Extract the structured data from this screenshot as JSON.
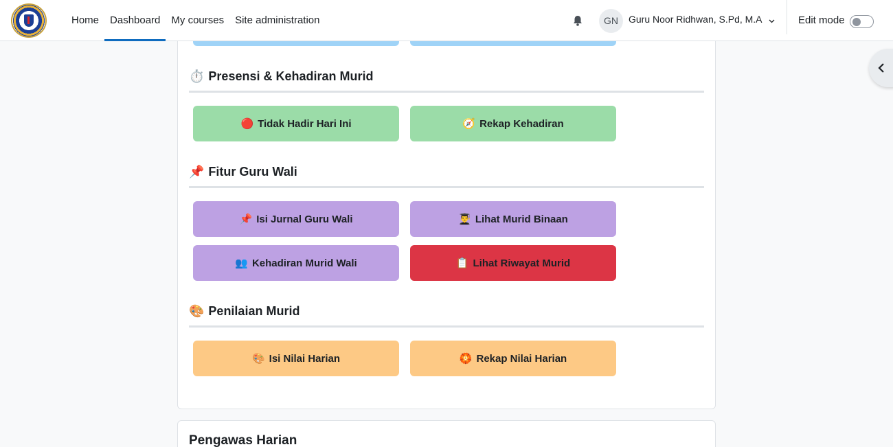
{
  "nav": {
    "links": [
      "Home",
      "Dashboard",
      "My courses",
      "Site administration"
    ],
    "active": "Dashboard",
    "avatar_initials": "GN",
    "user_name": "Guru Noor Ridhwan, S.Pd, M.A",
    "edit_mode_label": "Edit mode",
    "edit_mode_on": false
  },
  "colors": {
    "accent": "#0f6cbf",
    "blue_btn": "#9fd3f7",
    "green_btn": "#9bdca8",
    "purple_btn": "#bda1e3",
    "red_btn": "#dc3545",
    "orange_btn": "#fdc985"
  },
  "sections": {
    "presensi": {
      "icon": "⏱️",
      "title": "Presensi & Kehadiran Murid",
      "buttons": [
        {
          "icon": "🔴",
          "label": "Tidak Hadir Hari Ini"
        },
        {
          "icon": "🧭",
          "label": "Rekap Kehadiran"
        }
      ]
    },
    "guru_wali": {
      "icon": "📌",
      "title": "Fitur Guru Wali",
      "buttons": [
        {
          "icon": "📌",
          "label": "Isi Jurnal Guru Wali"
        },
        {
          "icon": "👨‍🎓",
          "label": "Lihat Murid Binaan"
        },
        {
          "icon": "👥",
          "label": "Kehadiran Murid Wali"
        },
        {
          "icon": "📋",
          "label": "Lihat Riwayat Murid"
        }
      ]
    },
    "penilaian": {
      "icon": "🎨",
      "title": "Penilaian Murid",
      "buttons": [
        {
          "icon": "🎨",
          "label": "Isi Nilai Harian"
        },
        {
          "icon": "🏵️",
          "label": "Rekap Nilai Harian"
        }
      ]
    }
  },
  "next_card": {
    "title": "Pengawas Harian"
  }
}
